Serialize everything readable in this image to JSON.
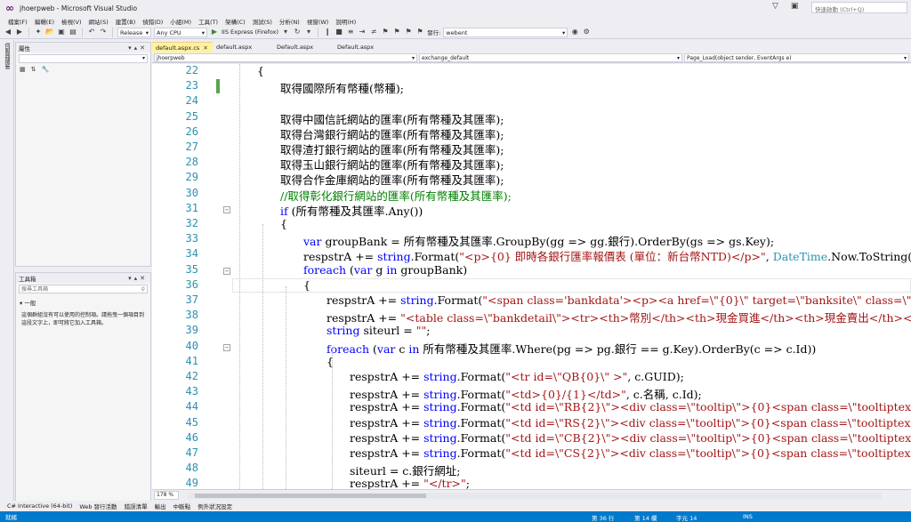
{
  "window": {
    "title": "jhoerpweb - Microsoft Visual Studio",
    "quick_launch": "快速啟動 (Ctrl+Q)"
  },
  "menu": [
    "檔案(F)",
    "編輯(E)",
    "檢視(V)",
    "網站(S)",
    "建置(B)",
    "偵錯(D)",
    "小組(M)",
    "工具(T)",
    "架構(C)",
    "測試(S)",
    "分析(N)",
    "視窗(W)",
    "說明(H)"
  ],
  "toolbar": {
    "config": "Release",
    "platform": "Any CPU",
    "run_label": "IIS Express (Firefox)",
    "publish_label": "發行:",
    "publish_target": "webent"
  },
  "server_explorer_tab": "伺服器總管",
  "properties": {
    "title": "屬性"
  },
  "toolbox": {
    "title": "工具箱",
    "search_placeholder": "搜尋工具箱",
    "group": "一般",
    "empty_message": "這個群組沒有可以使用的控制項。請拖曳一個項目到這段文字上，即可將它加入工具箱。"
  },
  "tabs": [
    "default.aspx.cs",
    "default.aspx",
    "Default.aspx",
    "Default.aspx"
  ],
  "nav": {
    "project": "jhoerpweb",
    "class": "exchange_default",
    "member": "Page_Load(object sender, EventArgs e)"
  },
  "editor": {
    "zoom": "178 %",
    "lines": [
      {
        "n": 22,
        "indent": 0,
        "tokens": [
          {
            "t": "{",
            "c": ""
          }
        ]
      },
      {
        "n": 23,
        "indent": 1,
        "tokens": [
          {
            "t": "取得國際所有幣種(幣種);",
            "c": ""
          }
        ]
      },
      {
        "n": 24,
        "indent": 0,
        "tokens": []
      },
      {
        "n": 25,
        "indent": 1,
        "tokens": [
          {
            "t": "取得中國信託網站的匯率(所有幣種及其匯率);",
            "c": ""
          }
        ]
      },
      {
        "n": 26,
        "indent": 1,
        "tokens": [
          {
            "t": "取得台灣銀行網站的匯率(所有幣種及其匯率);",
            "c": ""
          }
        ]
      },
      {
        "n": 27,
        "indent": 1,
        "tokens": [
          {
            "t": "取得渣打銀行網站的匯率(所有幣種及其匯率);",
            "c": ""
          }
        ]
      },
      {
        "n": 28,
        "indent": 1,
        "tokens": [
          {
            "t": "取得玉山銀行網站的匯率(所有幣種及其匯率);",
            "c": ""
          }
        ]
      },
      {
        "n": 29,
        "indent": 1,
        "tokens": [
          {
            "t": "取得合作金庫網站的匯率(所有幣種及其匯率);",
            "c": ""
          }
        ]
      },
      {
        "n": 30,
        "indent": 1,
        "tokens": [
          {
            "t": "//取得彰化銀行網站的匯率(所有幣種及其匯率);",
            "c": "cm"
          }
        ]
      },
      {
        "n": 31,
        "indent": 1,
        "tokens": [
          {
            "t": "if",
            "c": "kw"
          },
          {
            "t": " (所有幣種及其匯率.Any())",
            "c": ""
          }
        ]
      },
      {
        "n": 32,
        "indent": 1,
        "tokens": [
          {
            "t": "{",
            "c": ""
          }
        ]
      },
      {
        "n": 33,
        "indent": 2,
        "tokens": [
          {
            "t": "var",
            "c": "kw"
          },
          {
            "t": " groupBank = 所有幣種及其匯率.GroupBy(gg => gg.銀行).OrderBy(gs => gs.Key);",
            "c": ""
          }
        ]
      },
      {
        "n": 34,
        "indent": 2,
        "tokens": [
          {
            "t": "respstrA += ",
            "c": ""
          },
          {
            "t": "string",
            "c": "kw"
          },
          {
            "t": ".Format(",
            "c": ""
          },
          {
            "t": "\"<p>{0} 即時各銀行匯率報價表 (單位：新台幣NTD)</p>\"",
            "c": "str"
          },
          {
            "t": ", ",
            "c": ""
          },
          {
            "t": "DateTime",
            "c": "ty"
          },
          {
            "t": ".Now.ToString(",
            "c": ""
          },
          {
            "t": "\"yy",
            "c": "str"
          }
        ]
      },
      {
        "n": 35,
        "indent": 2,
        "tokens": [
          {
            "t": "foreach",
            "c": "kw"
          },
          {
            "t": " (",
            "c": ""
          },
          {
            "t": "var",
            "c": "kw"
          },
          {
            "t": " g ",
            "c": ""
          },
          {
            "t": "in",
            "c": "kw"
          },
          {
            "t": " groupBank)",
            "c": ""
          }
        ]
      },
      {
        "n": 36,
        "indent": 2,
        "tokens": [
          {
            "t": "{",
            "c": ""
          }
        ]
      },
      {
        "n": 37,
        "indent": 3,
        "tokens": [
          {
            "t": "respstrA += ",
            "c": ""
          },
          {
            "t": "string",
            "c": "kw"
          },
          {
            "t": ".Format(",
            "c": ""
          },
          {
            "t": "\"<span class='bankdata'><p><a href=\\\"{0}\\\" target=\\\"banksite\\\" class=\\\"bank",
            "c": "str"
          }
        ]
      },
      {
        "n": 38,
        "indent": 3,
        "tokens": [
          {
            "t": "respstrA += ",
            "c": ""
          },
          {
            "t": "\"<table class=\\\"bankdetail\\\"><tr><th>幣別</th><th>現金買進</th><th>現金賣出</th><th>即期買",
            "c": "str"
          }
        ]
      },
      {
        "n": 39,
        "indent": 3,
        "tokens": [
          {
            "t": "string",
            "c": "kw"
          },
          {
            "t": " siteurl = ",
            "c": ""
          },
          {
            "t": "\"\"",
            "c": "str"
          },
          {
            "t": ";",
            "c": ""
          }
        ]
      },
      {
        "n": 40,
        "indent": 3,
        "tokens": [
          {
            "t": "foreach",
            "c": "kw"
          },
          {
            "t": " (",
            "c": ""
          },
          {
            "t": "var",
            "c": "kw"
          },
          {
            "t": " c ",
            "c": ""
          },
          {
            "t": "in",
            "c": "kw"
          },
          {
            "t": " 所有幣種及其匯率.Where(pg => pg.銀行 == g.Key).OrderBy(c => c.Id))",
            "c": ""
          }
        ]
      },
      {
        "n": 41,
        "indent": 3,
        "tokens": [
          {
            "t": "{",
            "c": ""
          }
        ]
      },
      {
        "n": 42,
        "indent": 4,
        "tokens": [
          {
            "t": "respstrA += ",
            "c": ""
          },
          {
            "t": "string",
            "c": "kw"
          },
          {
            "t": ".Format(",
            "c": ""
          },
          {
            "t": "\"<tr id=\\\"QB{0}\\\" >\"",
            "c": "str"
          },
          {
            "t": ", c.GUID);",
            "c": ""
          }
        ]
      },
      {
        "n": 43,
        "indent": 4,
        "tokens": [
          {
            "t": "respstrA += ",
            "c": ""
          },
          {
            "t": "string",
            "c": "kw"
          },
          {
            "t": ".Format(",
            "c": ""
          },
          {
            "t": "\"<td>{0}/{1}</td>\"",
            "c": "str"
          },
          {
            "t": ", c.名稱, c.Id);",
            "c": ""
          }
        ]
      },
      {
        "n": 44,
        "indent": 4,
        "tokens": [
          {
            "t": "respstrA += ",
            "c": ""
          },
          {
            "t": "string",
            "c": "kw"
          },
          {
            "t": ".Format(",
            "c": ""
          },
          {
            "t": "\"<td id=\\\"RB{2}\\\"><div class=\\\"tooltip\\\">{0}<span class=\\\"tooltiptext\\",
            "c": "str"
          }
        ]
      },
      {
        "n": 45,
        "indent": 4,
        "tokens": [
          {
            "t": "respstrA += ",
            "c": ""
          },
          {
            "t": "string",
            "c": "kw"
          },
          {
            "t": ".Format(",
            "c": ""
          },
          {
            "t": "\"<td id=\\\"RS{2}\\\"><div class=\\\"tooltip\\\">{0}<span class=\\\"tooltiptext\\",
            "c": "str"
          }
        ]
      },
      {
        "n": 46,
        "indent": 4,
        "tokens": [
          {
            "t": "respstrA += ",
            "c": ""
          },
          {
            "t": "string",
            "c": "kw"
          },
          {
            "t": ".Format(",
            "c": ""
          },
          {
            "t": "\"<td id=\\\"CB{2}\\\"><div class=\\\"tooltip\\\">{0}<span class=\\\"tooltiptext\\",
            "c": "str"
          }
        ]
      },
      {
        "n": 47,
        "indent": 4,
        "tokens": [
          {
            "t": "respstrA += ",
            "c": ""
          },
          {
            "t": "string",
            "c": "kw"
          },
          {
            "t": ".Format(",
            "c": ""
          },
          {
            "t": "\"<td id=\\\"CS{2}\\\"><div class=\\\"tooltip\\\">{0}<span class=\\\"tooltiptext\\",
            "c": "str"
          }
        ]
      },
      {
        "n": 48,
        "indent": 4,
        "tokens": [
          {
            "t": "siteurl = c.銀行網址;",
            "c": ""
          }
        ]
      },
      {
        "n": 49,
        "indent": 4,
        "tokens": [
          {
            "t": "respstrA += ",
            "c": ""
          },
          {
            "t": "\"</tr>\"",
            "c": "str"
          },
          {
            "t": ";",
            "c": ""
          }
        ]
      }
    ]
  },
  "bottom_tabs": [
    "C# Interactive (64-bit)",
    "Web 發行活動",
    "錯誤清單",
    "輸出",
    "中斷點",
    "例外狀況設定"
  ],
  "status": {
    "ready": "就緒",
    "line": "第 36 行",
    "col": "第 14 欄",
    "char": "字元 14",
    "ins": "INS"
  }
}
